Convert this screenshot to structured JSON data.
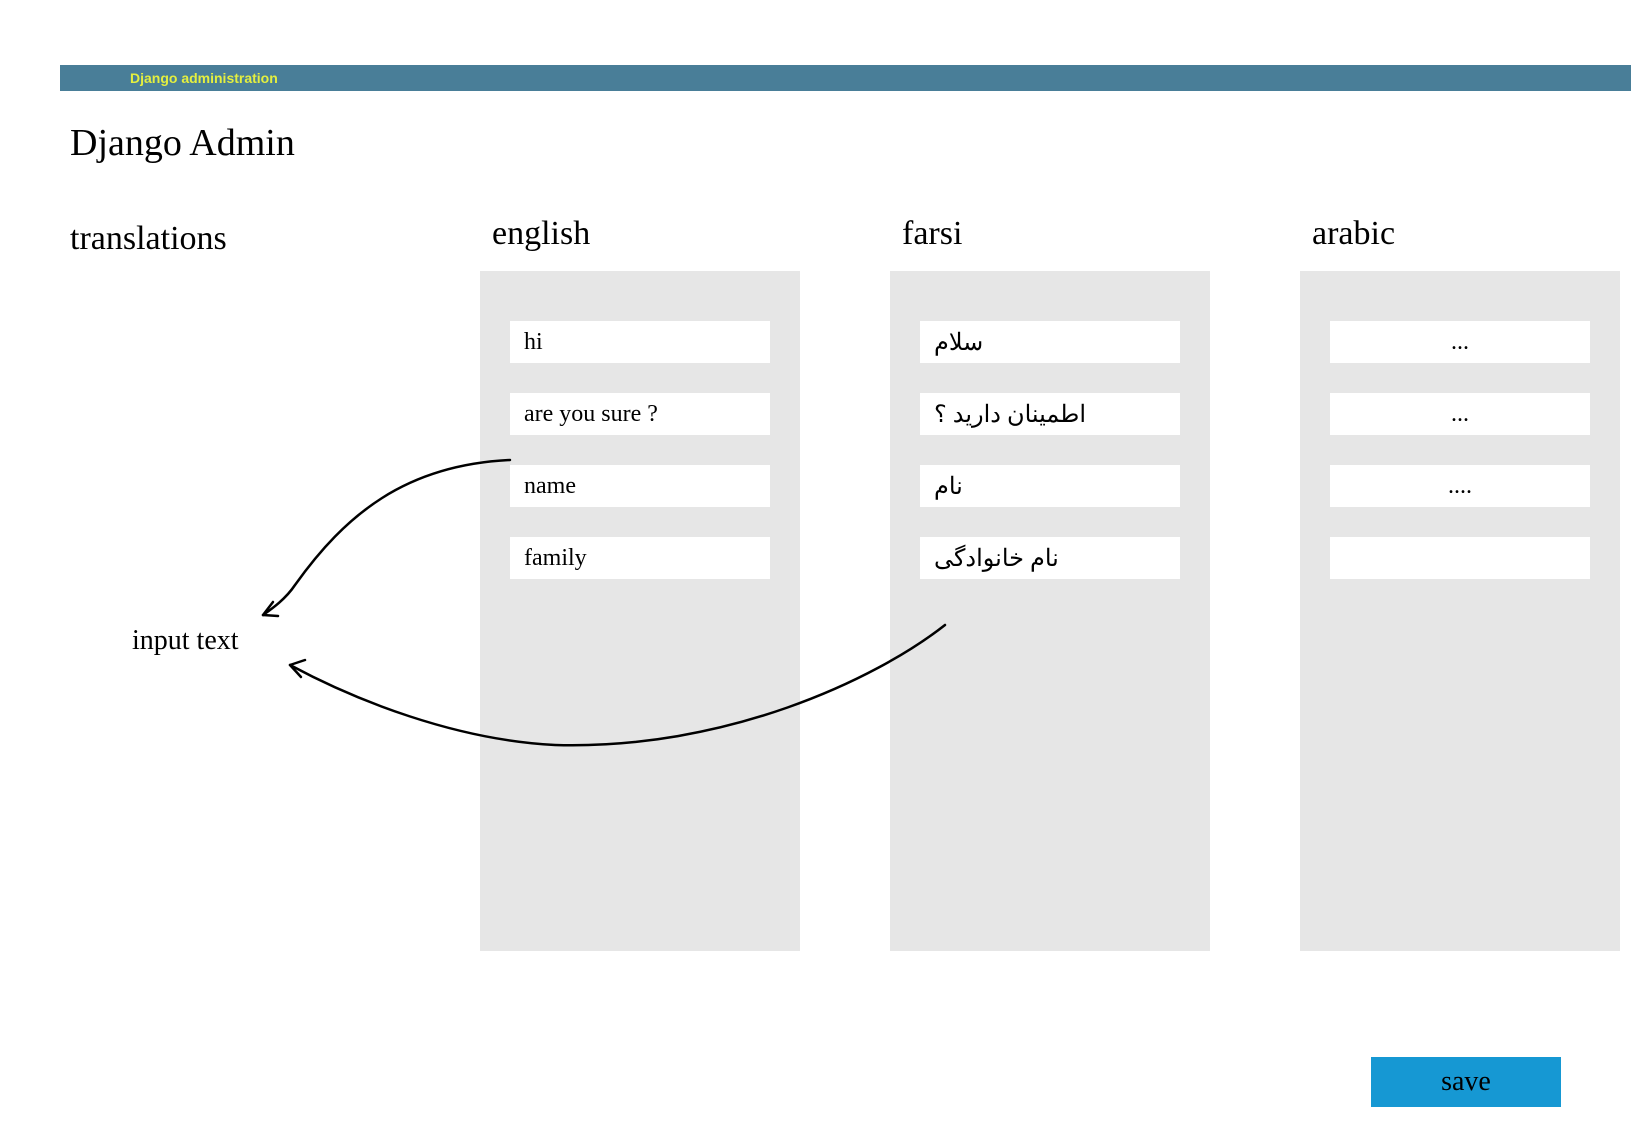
{
  "header": {
    "brand": "Django administration"
  },
  "page": {
    "title": "Django Admin",
    "section": "translations"
  },
  "columns": {
    "english": {
      "header": "english",
      "fields": [
        "hi",
        "are you sure ?",
        "name",
        "family"
      ]
    },
    "farsi": {
      "header": "farsi",
      "fields": [
        "سلام",
        "اطمینان دارید ؟",
        "نام",
        "نام خانوادگی"
      ]
    },
    "arabic": {
      "header": "arabic",
      "fields": [
        "...",
        "...",
        "....",
        ""
      ]
    }
  },
  "annotation": {
    "label": "input text"
  },
  "actions": {
    "save": "save"
  }
}
